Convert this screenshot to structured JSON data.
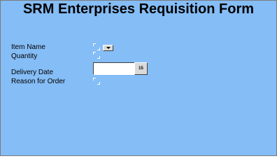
{
  "title": "SRM Enterprises Requisition Form",
  "fields": {
    "item_name": {
      "label": "Item Name",
      "value": ""
    },
    "quantity": {
      "label": "Quantity",
      "value": ""
    },
    "delivery_date": {
      "label": "Delivery Date",
      "value": "",
      "calendar_button": "15"
    },
    "reason": {
      "label": "Reason for Order",
      "value": ""
    }
  },
  "colors": {
    "background": "#85bdf6",
    "text": "#000000",
    "field": "#ffffff",
    "button": "#d9d9d9"
  },
  "icons": {
    "item_name_dropdown": "chevron-down-icon",
    "calendar": "calendar-icon"
  }
}
